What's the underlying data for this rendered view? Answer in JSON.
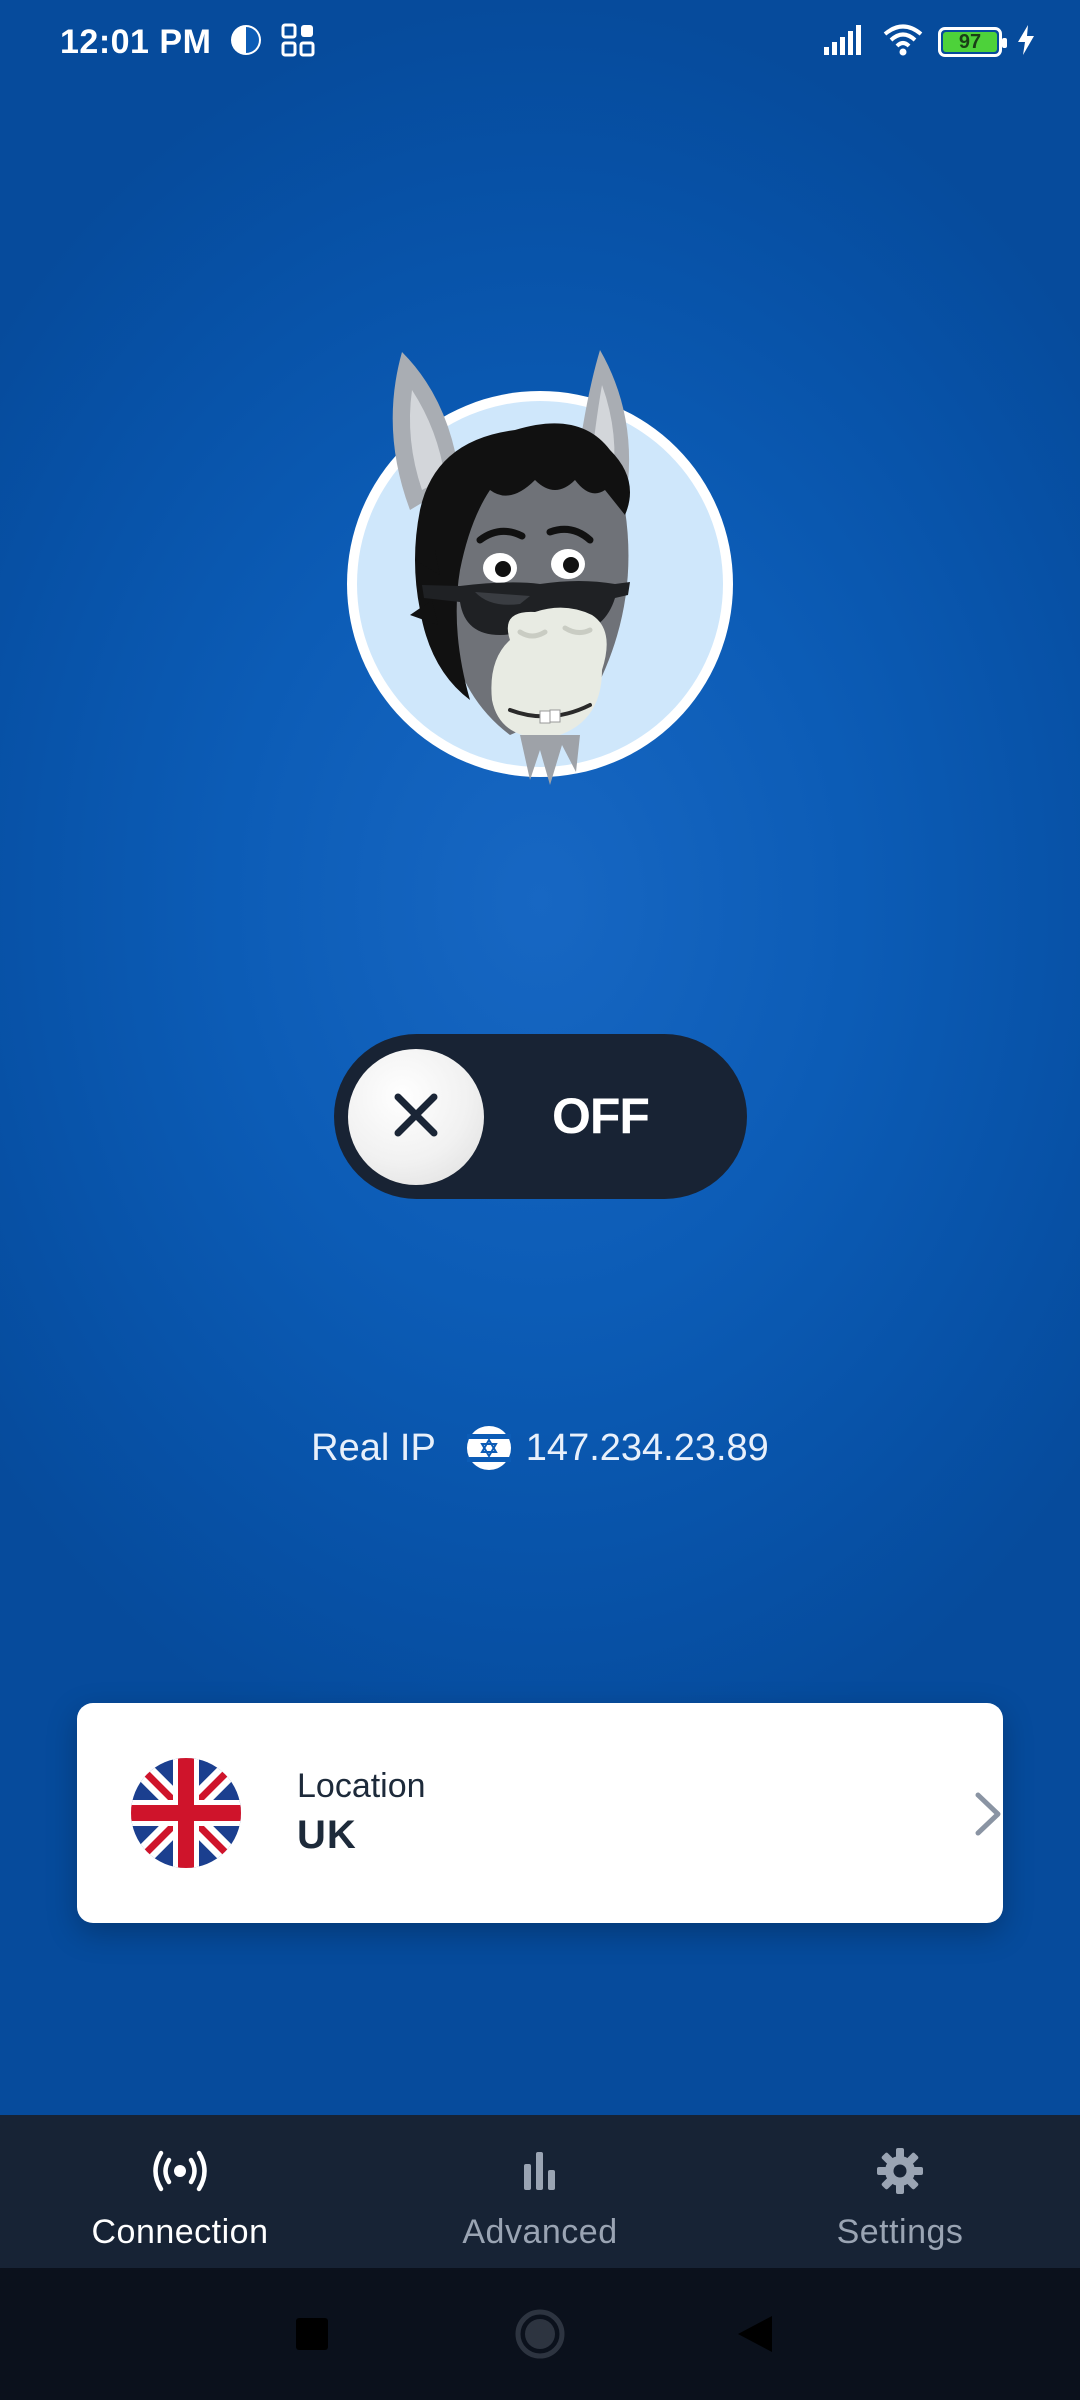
{
  "status_bar": {
    "time": "12:01 PM",
    "battery_level": "97",
    "icons": [
      "notification-app-icon",
      "qr-app-icon",
      "signal-icon",
      "wifi-icon",
      "battery-icon",
      "charging-icon"
    ]
  },
  "vpn_toggle": {
    "state_label": "OFF",
    "knob_icon": "close-icon"
  },
  "ip_info": {
    "label": "Real IP",
    "flag_icon": "israel-flag-icon",
    "address": "147.234.23.89"
  },
  "location": {
    "caption": "Location",
    "value": "UK",
    "flag_icon": "uk-flag-icon"
  },
  "bottom_nav": {
    "items": [
      {
        "label": "Connection",
        "icon": "broadcast-icon",
        "active": true
      },
      {
        "label": "Advanced",
        "icon": "bar-chart-icon",
        "active": false
      },
      {
        "label": "Settings",
        "icon": "gear-icon",
        "active": false
      }
    ]
  },
  "colors": {
    "background": "#0c5cb6",
    "toggle_bg": "#182334",
    "nav_bg": "#172335",
    "system_nav_bg": "#0b111c",
    "battery_green": "#4dd23a"
  }
}
